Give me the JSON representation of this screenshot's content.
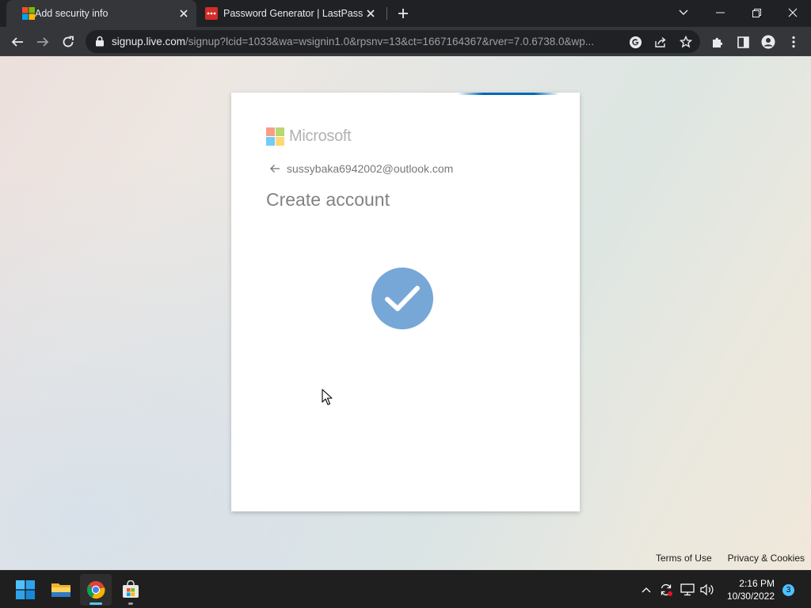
{
  "browser": {
    "tabs": [
      {
        "title": "Add security info",
        "favicon": "microsoft-logo-icon",
        "active": true
      },
      {
        "title": "Password Generator | LastPass",
        "favicon": "lastpass-icon",
        "active": false
      }
    ],
    "address_bar": {
      "host": "signup.live.com",
      "path": "/signup?lcid=1033&wa=wsignin1.0&rpsnv=13&ct=1667164367&rver=7.0.6738.0&wp..."
    }
  },
  "signup_card": {
    "brand": "Microsoft",
    "identity_email": "sussybaka6942002@outlook.com",
    "heading": "Create account",
    "status_icon": "checkmark-icon",
    "accent_color": "#0067b8",
    "check_color": "#76a7d6"
  },
  "footer": {
    "terms": "Terms of Use",
    "privacy": "Privacy & Cookies"
  },
  "taskbar": {
    "apps": [
      "windows-start-icon",
      "file-explorer-icon",
      "chrome-icon",
      "microsoft-store-icon"
    ],
    "time": "2:16 PM",
    "date": "10/30/2022",
    "notification_count": "3"
  }
}
